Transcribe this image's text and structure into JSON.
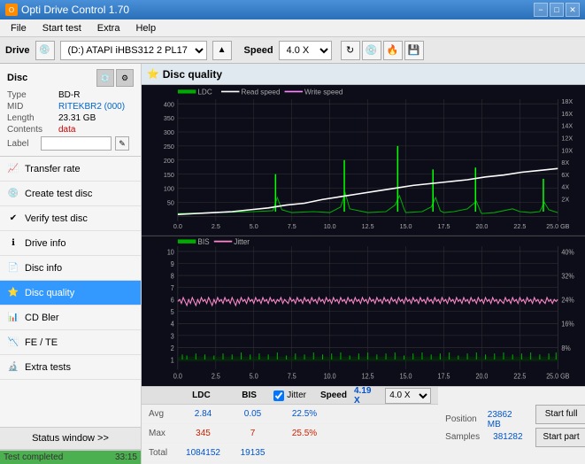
{
  "titleBar": {
    "title": "Opti Drive Control 1.70",
    "icon": "O",
    "buttons": {
      "minimize": "−",
      "maximize": "□",
      "close": "✕"
    }
  },
  "menuBar": {
    "items": [
      "File",
      "Start test",
      "Extra",
      "Help"
    ]
  },
  "driveBar": {
    "label": "Drive",
    "driveValue": "(D:)  ATAPI iHBS312  2 PL17",
    "speedLabel": "Speed",
    "speedValue": "4.0 X"
  },
  "disc": {
    "label": "Disc",
    "type": {
      "key": "Type",
      "value": "BD-R"
    },
    "mid": {
      "key": "MID",
      "value": "RITEKBR2 (000)"
    },
    "length": {
      "key": "Length",
      "value": "23.31 GB"
    },
    "contents": {
      "key": "Contents",
      "value": "data"
    },
    "label_key": "Label",
    "label_value": ""
  },
  "navItems": [
    {
      "id": "transfer-rate",
      "label": "Transfer rate",
      "icon": "📈"
    },
    {
      "id": "create-test-disc",
      "label": "Create test disc",
      "icon": "💿"
    },
    {
      "id": "verify-test-disc",
      "label": "Verify test disc",
      "icon": "✔"
    },
    {
      "id": "drive-info",
      "label": "Drive info",
      "icon": "ℹ"
    },
    {
      "id": "disc-info",
      "label": "Disc info",
      "icon": "📄"
    },
    {
      "id": "disc-quality",
      "label": "Disc quality",
      "icon": "⭐",
      "active": true
    },
    {
      "id": "cd-bler",
      "label": "CD Bler",
      "icon": "📊"
    },
    {
      "id": "fe-te",
      "label": "FE / TE",
      "icon": "📉"
    },
    {
      "id": "extra-tests",
      "label": "Extra tests",
      "icon": "🔬"
    }
  ],
  "statusBar": {
    "buttonLabel": "Status window >>",
    "progressPercent": 100,
    "progressLabel": "Test completed",
    "timeLabel": "33:15"
  },
  "chartHeader": {
    "title": "Disc quality",
    "icon": "⭐"
  },
  "topChart": {
    "legend": {
      "ldc": "LDC",
      "readSpeed": "Read speed",
      "writeSpeed": "Write speed"
    },
    "yAxisLeft": [
      "400",
      "350",
      "300",
      "250",
      "200",
      "150",
      "100",
      "50"
    ],
    "yAxisRight": [
      "18X",
      "16X",
      "14X",
      "12X",
      "10X",
      "8X",
      "6X",
      "4X",
      "2X"
    ],
    "xAxis": [
      "0.0",
      "2.5",
      "5.0",
      "7.5",
      "10.0",
      "12.5",
      "15.0",
      "17.5",
      "20.0",
      "22.5",
      "25.0 GB"
    ]
  },
  "bottomChart": {
    "title": "BIS",
    "legend": {
      "jitter": "Jitter"
    },
    "yAxisLeft": [
      "10",
      "9",
      "8",
      "7",
      "6",
      "5",
      "4",
      "3",
      "2",
      "1"
    ],
    "yAxisRight": [
      "40%",
      "32%",
      "24%",
      "16%",
      "8%"
    ],
    "xAxis": [
      "0.0",
      "2.5",
      "5.0",
      "7.5",
      "10.0",
      "12.5",
      "15.0",
      "17.5",
      "20.0",
      "22.5",
      "25.0 GB"
    ]
  },
  "stats": {
    "columns": {
      "ldc": "LDC",
      "bis": "BIS",
      "jitter": "Jitter",
      "speed": "Speed",
      "speedVal": "4.19 X",
      "speedSelect": "4.0 X"
    },
    "rows": {
      "avg": {
        "label": "Avg",
        "ldc": "2.84",
        "bis": "0.05",
        "jitter": "22.5%"
      },
      "max": {
        "label": "Max",
        "ldc": "345",
        "bis": "7",
        "jitter": "25.5%"
      },
      "total": {
        "label": "Total",
        "ldc": "1084152",
        "bis": "19135",
        "jitter": ""
      }
    },
    "position": {
      "posLabel": "Position",
      "posValue": "23862 MB",
      "samplesLabel": "Samples",
      "samplesValue": "381282"
    },
    "jitterCheck": true,
    "startFull": "Start full",
    "startPart": "Start part"
  }
}
